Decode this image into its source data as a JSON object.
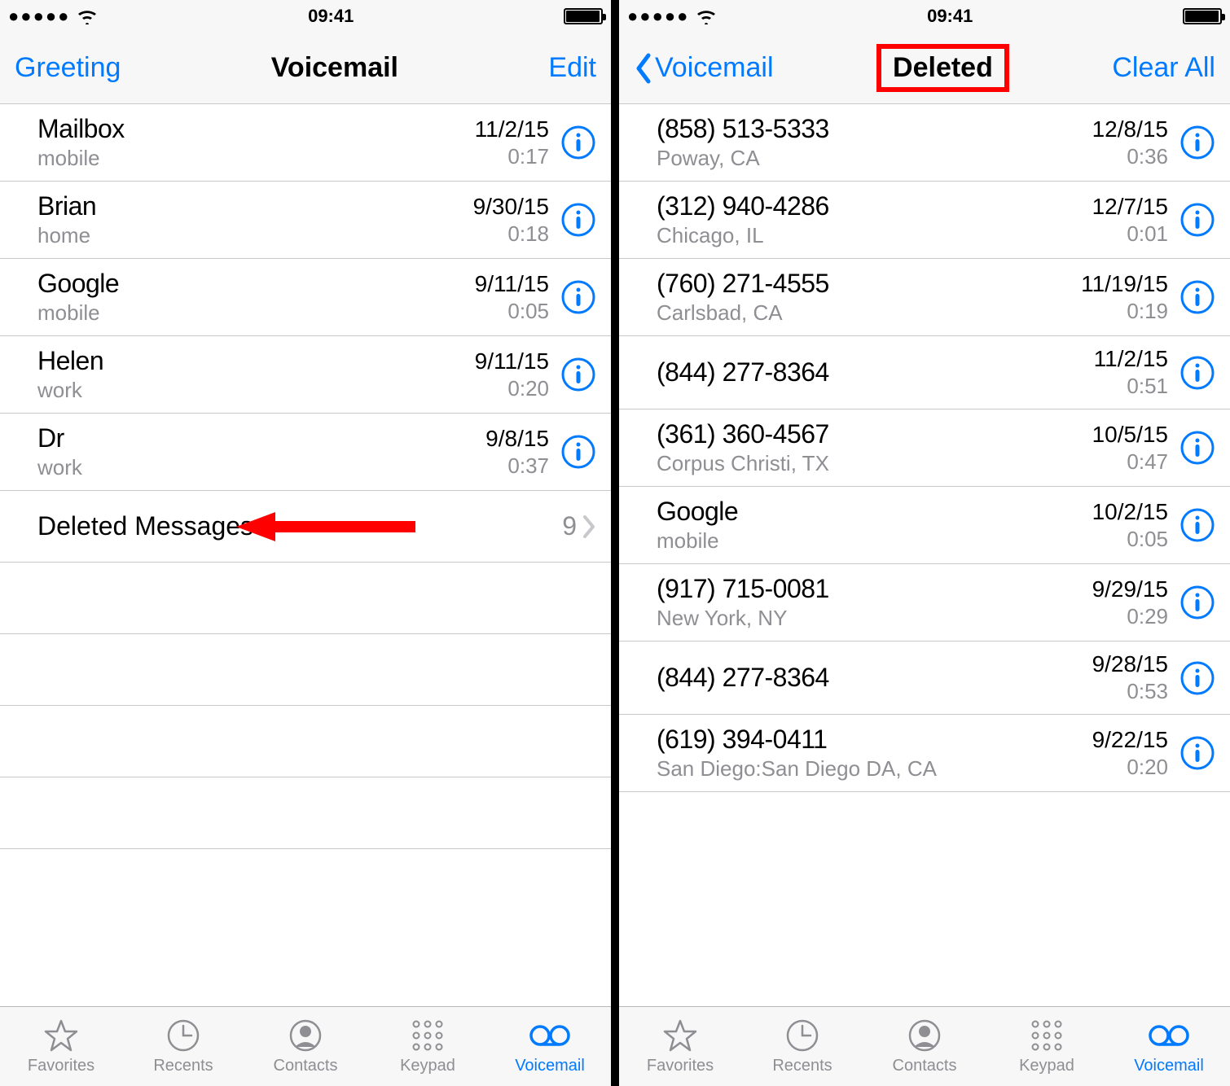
{
  "status": {
    "time": "09:41"
  },
  "left_phone": {
    "nav": {
      "left": "Greeting",
      "title": "Voicemail",
      "right": "Edit"
    },
    "rows": [
      {
        "name": "Mailbox",
        "sub": "mobile",
        "date": "11/2/15",
        "dur": "0:17"
      },
      {
        "name": "Brian",
        "sub": "home",
        "date": "9/30/15",
        "dur": "0:18"
      },
      {
        "name": "Google",
        "sub": "mobile",
        "date": "9/11/15",
        "dur": "0:05"
      },
      {
        "name": "Helen",
        "sub": "work",
        "date": "9/11/15",
        "dur": "0:20"
      },
      {
        "name": "Dr",
        "sub": "work",
        "date": "9/8/15",
        "dur": "0:37"
      }
    ],
    "deleted": {
      "label": "Deleted Messages",
      "count": "9"
    }
  },
  "right_phone": {
    "nav": {
      "back": "Voicemail",
      "title": "Deleted",
      "right": "Clear All"
    },
    "rows": [
      {
        "name": "(858) 513-5333",
        "sub": "Poway, CA",
        "date": "12/8/15",
        "dur": "0:36"
      },
      {
        "name": "(312) 940-4286",
        "sub": "Chicago, IL",
        "date": "12/7/15",
        "dur": "0:01"
      },
      {
        "name": "(760) 271-4555",
        "sub": "Carlsbad, CA",
        "date": "11/19/15",
        "dur": "0:19"
      },
      {
        "name": "(844) 277-8364",
        "sub": "",
        "date": "11/2/15",
        "dur": "0:51"
      },
      {
        "name": "(361) 360-4567",
        "sub": "Corpus Christi, TX",
        "date": "10/5/15",
        "dur": "0:47"
      },
      {
        "name": "Google",
        "sub": "mobile",
        "date": "10/2/15",
        "dur": "0:05"
      },
      {
        "name": "(917) 715-0081",
        "sub": "New York, NY",
        "date": "9/29/15",
        "dur": "0:29"
      },
      {
        "name": "(844) 277-8364",
        "sub": "",
        "date": "9/28/15",
        "dur": "0:53"
      },
      {
        "name": "(619) 394-0411",
        "sub": "San Diego:San Diego DA, CA",
        "date": "9/22/15",
        "dur": "0:20"
      }
    ]
  },
  "tabs": {
    "favorites": "Favorites",
    "recents": "Recents",
    "contacts": "Contacts",
    "keypad": "Keypad",
    "voicemail": "Voicemail"
  }
}
